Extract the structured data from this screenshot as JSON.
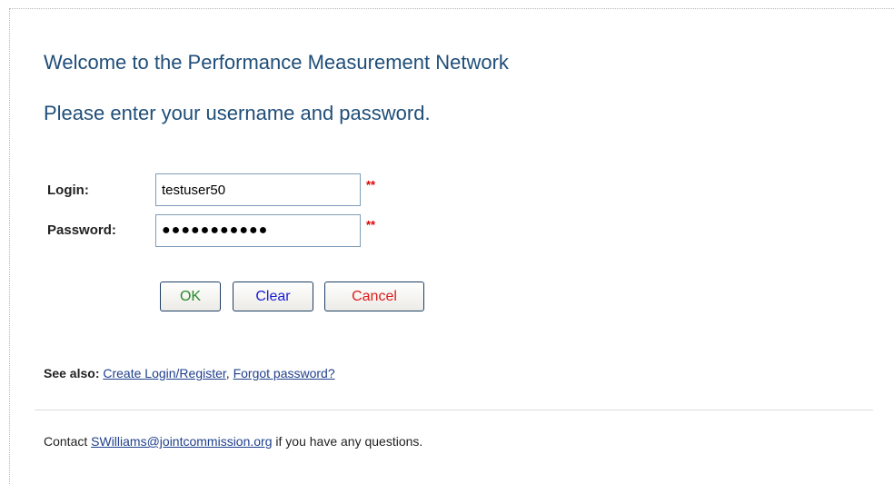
{
  "header": {
    "welcome": "Welcome to the Performance Measurement Network",
    "prompt": "Please enter your username and password."
  },
  "form": {
    "login_label": "Login:",
    "login_value": "testuser50",
    "password_label": "Password:",
    "password_value": "●●●●●●●●●●●",
    "required_marker": "**",
    "ok_label": "OK",
    "clear_label": "Clear",
    "cancel_label": "Cancel"
  },
  "see_also": {
    "label": "See also:",
    "create_link": "Create Login/Register",
    "separator": ",",
    "forgot_link": "Forgot password?"
  },
  "contact": {
    "prefix": "Contact",
    "email": "SWilliams@jointcommission.org",
    "suffix": "if you have any questions."
  },
  "colors": {
    "heading": "#1f4e79",
    "ok": "#2a8a2a",
    "clear": "#1b1bd6",
    "cancel": "#dd1c1c",
    "required": "#dd0000"
  }
}
